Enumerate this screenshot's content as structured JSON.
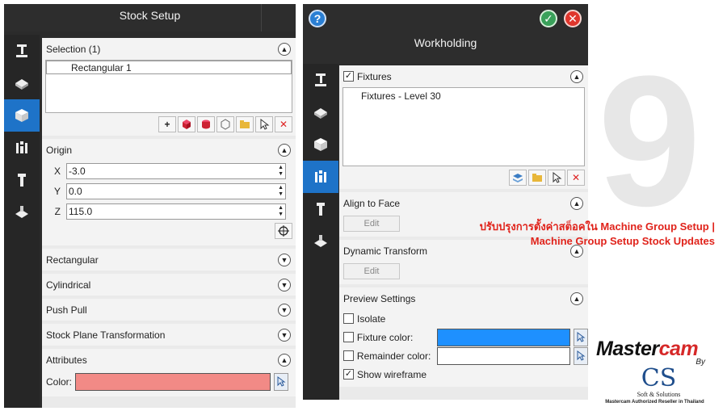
{
  "stock_setup": {
    "title": "Stock Setup",
    "selection": {
      "header": "Selection (1)",
      "items": [
        "Rectangular 1"
      ]
    },
    "origin": {
      "header": "Origin",
      "x_label": "X",
      "x_value": "-3.0",
      "y_label": "Y",
      "y_value": "0.0",
      "z_label": "Z",
      "z_value": "115.0"
    },
    "sections": [
      "Rectangular",
      "Cylindrical",
      "Push Pull",
      "Stock Plane Transformation"
    ],
    "attributes": {
      "header": "Attributes",
      "color_label": "Color:",
      "color_value": "#f28a86"
    }
  },
  "workholding": {
    "title": "Workholding",
    "fixtures": {
      "label": "Fixtures",
      "checked": true,
      "items": [
        "Fixtures - Level 30"
      ]
    },
    "align_to_face": {
      "header": "Align to Face",
      "edit_label": "Edit"
    },
    "dynamic_transform": {
      "header": "Dynamic Transform",
      "edit_label": "Edit"
    },
    "preview_settings": {
      "header": "Preview Settings",
      "isolate_label": "Isolate",
      "fixture_color_label": "Fixture color:",
      "fixture_color_value": "#1e90ff",
      "remainder_color_label": "Remainder color:",
      "remainder_color_value": "#ffffff",
      "show_wireframe_label": "Show wireframe",
      "show_wireframe_checked": true
    }
  },
  "decor": {
    "big_number": "9",
    "promo_line1": "ปรับปรุงการตั้งค่าสต็อคใน Machine Group Setup |",
    "promo_line2": "Machine Group Setup Stock Updates",
    "brand_master": "Master",
    "brand_cam": "cam",
    "brand_by": "By",
    "brand_cs": "CS",
    "brand_soft": "Soft & Solutions",
    "brand_reseller": "Mastercam Authorized Reseller in Thailand"
  },
  "colors": {
    "accent": "#1e73c8",
    "confirm": "#3aa15a",
    "cancel": "#e0362c",
    "help": "#2a7fd4",
    "promo": "#e0231b"
  }
}
